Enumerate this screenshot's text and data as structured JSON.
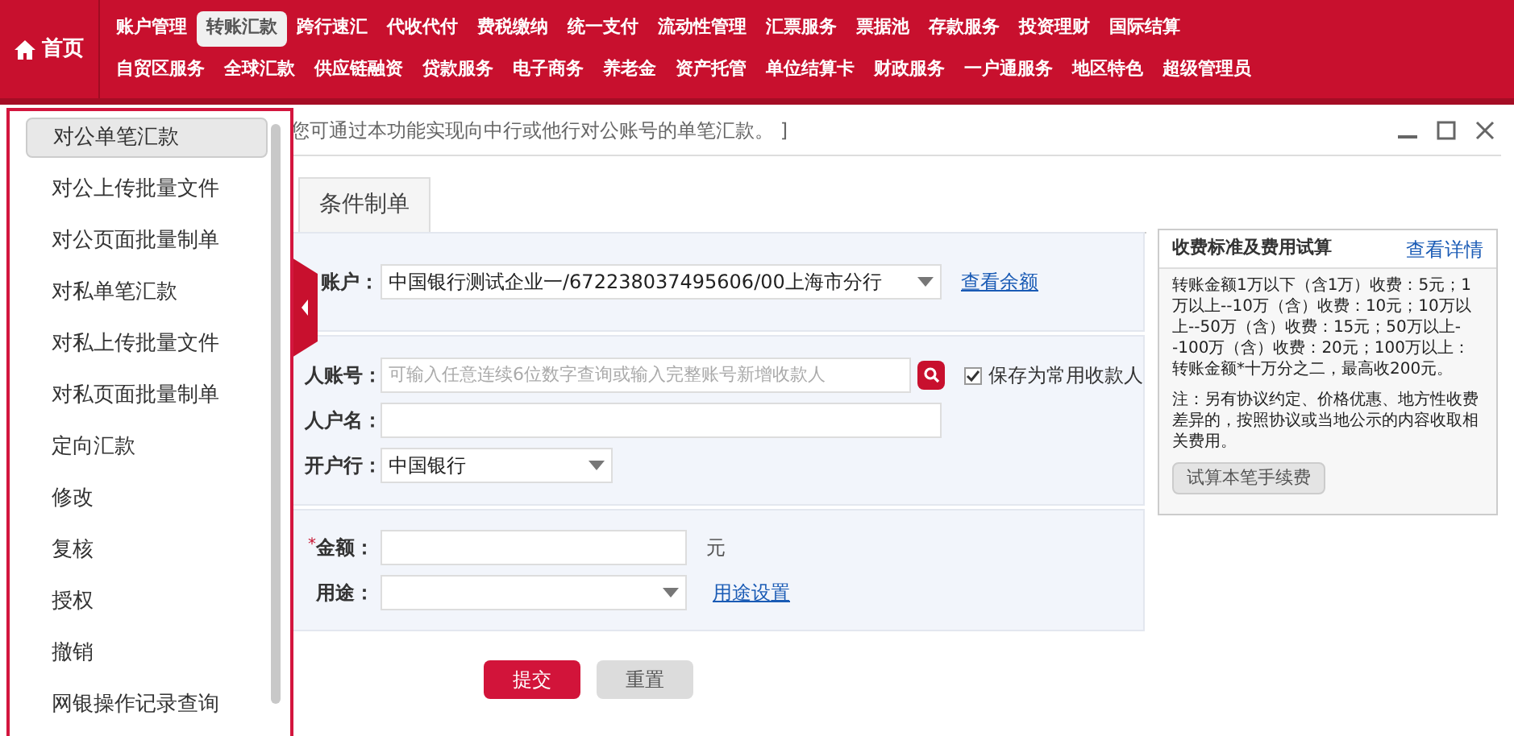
{
  "nav": {
    "home": "首页",
    "rows": [
      [
        {
          "label": "账户管理",
          "selected": false
        },
        {
          "label": "转账汇款",
          "selected": true
        },
        {
          "label": "跨行速汇",
          "selected": false
        },
        {
          "label": "代收代付",
          "selected": false
        },
        {
          "label": "费税缴纳",
          "selected": false
        },
        {
          "label": "统一支付",
          "selected": false
        },
        {
          "label": "流动性管理",
          "selected": false
        },
        {
          "label": "汇票服务",
          "selected": false
        },
        {
          "label": "票据池",
          "selected": false
        },
        {
          "label": "存款服务",
          "selected": false
        },
        {
          "label": "投资理财",
          "selected": false
        },
        {
          "label": "国际结算",
          "selected": false
        }
      ],
      [
        {
          "label": "自贸区服务",
          "selected": false
        },
        {
          "label": "全球汇款",
          "selected": false
        },
        {
          "label": "供应链融资",
          "selected": false
        },
        {
          "label": "贷款服务",
          "selected": false
        },
        {
          "label": "电子商务",
          "selected": false
        },
        {
          "label": "养老金",
          "selected": false
        },
        {
          "label": "资产托管",
          "selected": false
        },
        {
          "label": "单位结算卡",
          "selected": false
        },
        {
          "label": "财政服务",
          "selected": false
        },
        {
          "label": "一户通服务",
          "selected": false
        },
        {
          "label": "地区特色",
          "selected": false
        },
        {
          "label": "超级管理员",
          "selected": false
        }
      ]
    ]
  },
  "menu": [
    {
      "label": "对公单笔汇款",
      "selected": true
    },
    {
      "label": "对公上传批量文件",
      "selected": false
    },
    {
      "label": "对公页面批量制单",
      "selected": false
    },
    {
      "label": "对私单笔汇款",
      "selected": false
    },
    {
      "label": "对私上传批量文件",
      "selected": false
    },
    {
      "label": "对私页面批量制单",
      "selected": false
    },
    {
      "label": "定向汇款",
      "selected": false
    },
    {
      "label": "修改",
      "selected": false
    },
    {
      "label": "复核",
      "selected": false
    },
    {
      "label": "授权",
      "selected": false
    },
    {
      "label": "撤销",
      "selected": false
    },
    {
      "label": "网银操作记录查询",
      "selected": false
    }
  ],
  "hint": "您可通过本功能实现向中行或他行对公账号的单笔汇款。 ]",
  "tab": "条件制单",
  "form": {
    "payer_label": "账户：",
    "payer_value": "中国银行测试企业一/672238037495606/00上海市分行",
    "balance_link": "查看余额",
    "payee_account_label": "人账号：",
    "payee_account_placeholder": "可输入任意连续6位数字查询或输入完整账号新增收款人",
    "save_payee": {
      "label": "保存为常用收款人",
      "checked": true
    },
    "payee_name_label": "人户名：",
    "bank_label": "开户行：",
    "bank_value": "中国银行",
    "amount_label": "金额：",
    "amount_required": "*",
    "unit": "元",
    "purpose_label": "用途：",
    "purpose_link": "用途设置"
  },
  "buttons": {
    "submit": "提交",
    "reset": "重置"
  },
  "fee_panel": {
    "title": "收费标准及费用试算",
    "link": "查看详情",
    "text": "转账金额1万以下（含1万）收费：5元；1万以上--10万（含）收费：10元；10万以上--50万（含）收费：15元；50万以上--100万（含）收费：20元；100万以上：转账金额*十万分之二，最高收200元。",
    "note": "注：另有协议约定、价格优惠、地方性收费差异的，按照协议或当地公示的内容收取相关费用。",
    "button": "试算本笔手续费"
  }
}
